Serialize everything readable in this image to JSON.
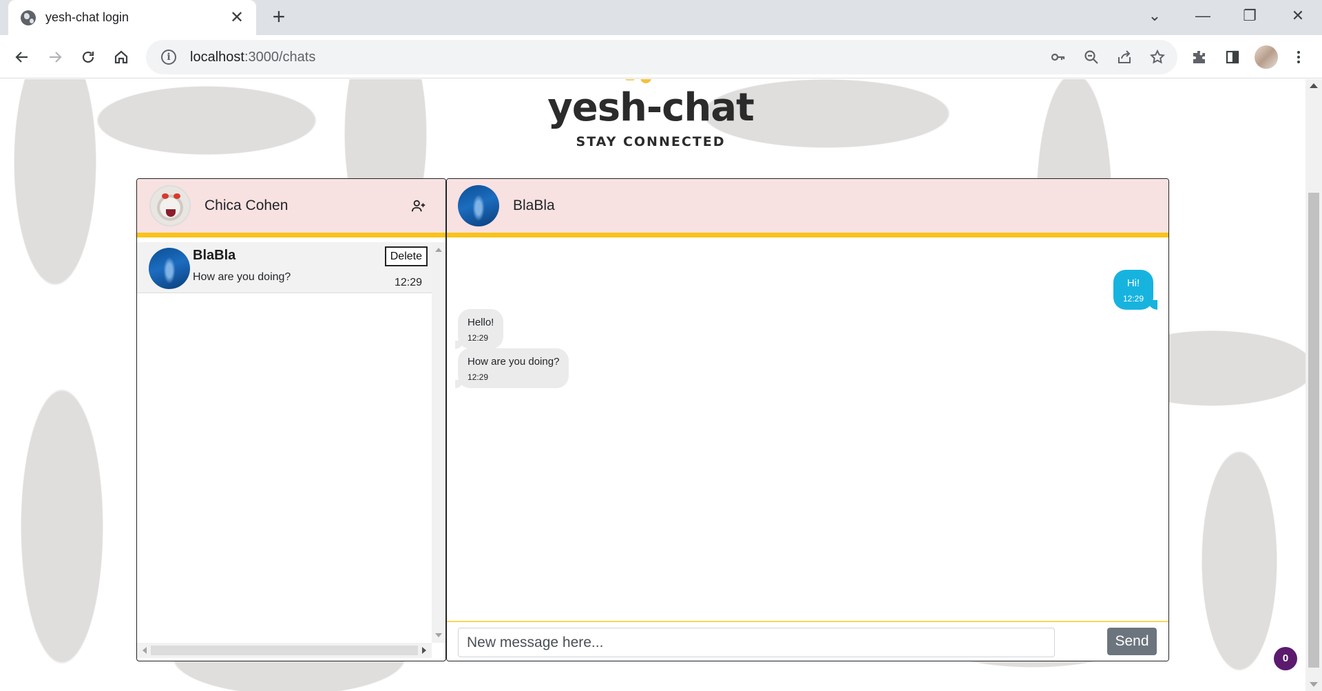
{
  "browser": {
    "tab_title": "yesh-chat login",
    "tab_close": "✕",
    "new_tab": "+",
    "url_host": "localhost",
    "url_path": ":3000/chats",
    "win_dropdown": "⌄",
    "win_minimize": "—",
    "win_restore": "❐",
    "win_close": "✕"
  },
  "logo": {
    "title": "yesh-chat",
    "subtitle": "STAY CONNECTED",
    "colors": {
      "text": "#2b2b2b",
      "accent": "#f3c13a"
    }
  },
  "sidebar": {
    "user_name": "Chica Cohen",
    "add_contact_icon": "person-plus-icon",
    "contacts": [
      {
        "name": "BlaBla",
        "last_message": "How are you doing?",
        "time": "12:29",
        "delete_label": "Delete"
      }
    ]
  },
  "chat": {
    "contact_name": "BlaBla",
    "messages": [
      {
        "direction": "out",
        "text": "Hi!",
        "time": "12:29"
      },
      {
        "direction": "in",
        "text": "Hello!",
        "time": "12:29"
      },
      {
        "direction": "in",
        "text": "How are you doing?",
        "time": "12:29"
      }
    ],
    "composer": {
      "placeholder": "New message here...",
      "send_label": "Send"
    }
  },
  "badge": {
    "count": "0"
  },
  "colors": {
    "header_bg": "#f8e1e1",
    "header_border": "#fbc21a",
    "outgoing_bubble": "#17b3df",
    "incoming_bubble": "#ebebeb",
    "send_button": "#6c757d",
    "badge": "#5b1a6e"
  }
}
